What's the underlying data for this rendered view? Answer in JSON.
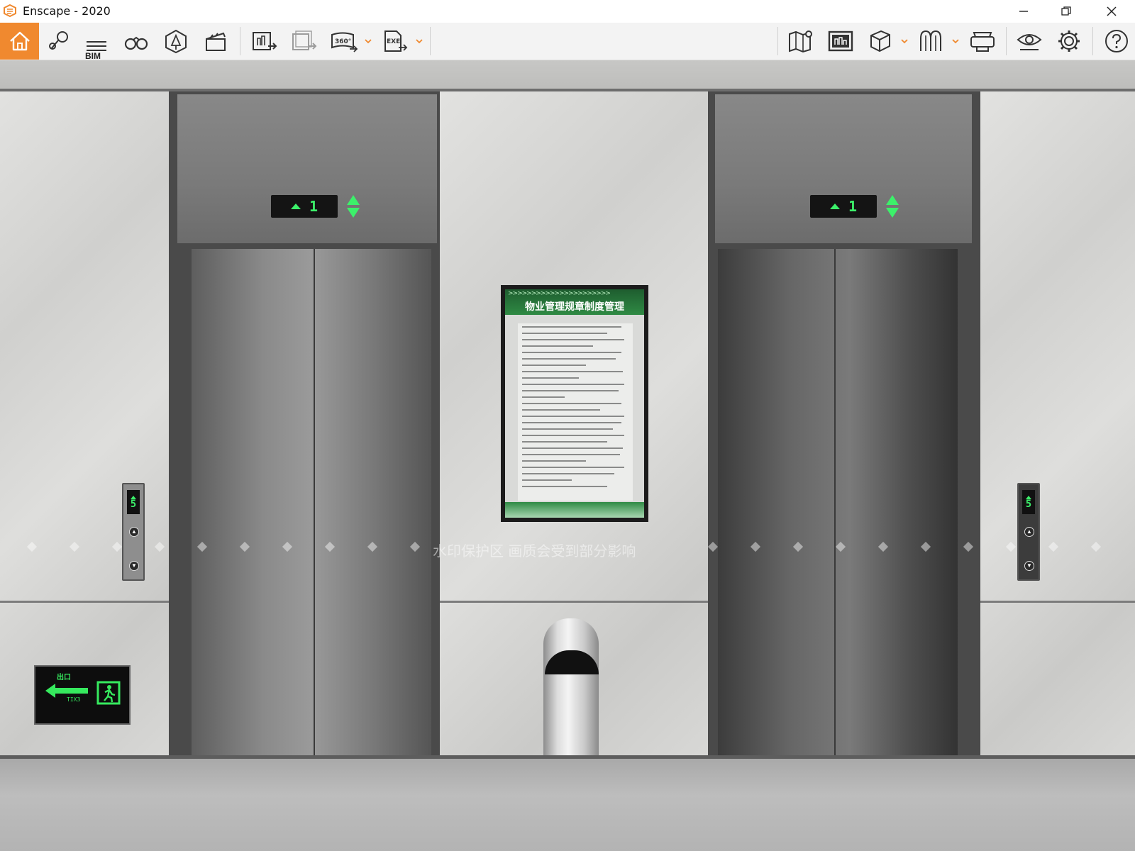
{
  "window": {
    "title": "Enscape - 2020",
    "controls": {
      "minimize": "minimize-icon",
      "restore": "restore-icon",
      "close": "close-icon"
    }
  },
  "toolbar": {
    "left_tools": [
      {
        "name": "home",
        "icon": "home-icon"
      },
      {
        "name": "views",
        "icon": "map-pin-icon"
      },
      {
        "name": "bim",
        "icon": "bim-list-icon",
        "label": "BIM"
      },
      {
        "name": "binoculars",
        "icon": "binoculars-icon"
      },
      {
        "name": "assets",
        "icon": "asset-library-icon"
      },
      {
        "name": "video",
        "icon": "clapperboard-icon"
      },
      {
        "name": "screenshot",
        "icon": "screenshot-export-icon"
      },
      {
        "name": "batch",
        "icon": "batch-export-icon"
      },
      {
        "name": "pano",
        "icon": "panorama-icon",
        "label": "360°"
      },
      {
        "name": "exe",
        "icon": "exe-export-icon",
        "label": "EXE"
      }
    ],
    "right_tools": [
      {
        "name": "map",
        "icon": "map-icon"
      },
      {
        "name": "screenshot-sync",
        "icon": "render-window-icon"
      },
      {
        "name": "cube",
        "icon": "cube-icon"
      },
      {
        "name": "tree",
        "icon": "vegetation-icon"
      },
      {
        "name": "vr",
        "icon": "vr-headset-icon"
      },
      {
        "name": "visual",
        "icon": "eye-settings-icon"
      },
      {
        "name": "settings",
        "icon": "gear-icon"
      },
      {
        "name": "help",
        "icon": "help-icon"
      }
    ],
    "accent": "#f0892f"
  },
  "scene": {
    "left_elevator_floor": "1",
    "right_elevator_floor": "1",
    "left_call_panel_floor": "5",
    "right_call_panel_floor": "5",
    "notice_title": "物业管理规章制度管理",
    "notice_chevrons": ">>>>>>>>>>>>>>>>>>>>>>",
    "exit_label": "出口",
    "exit_sub": "TIX3",
    "watermark_text": "水印保护区 画质会受到部分影响",
    "display_color": "#3cf06a"
  }
}
